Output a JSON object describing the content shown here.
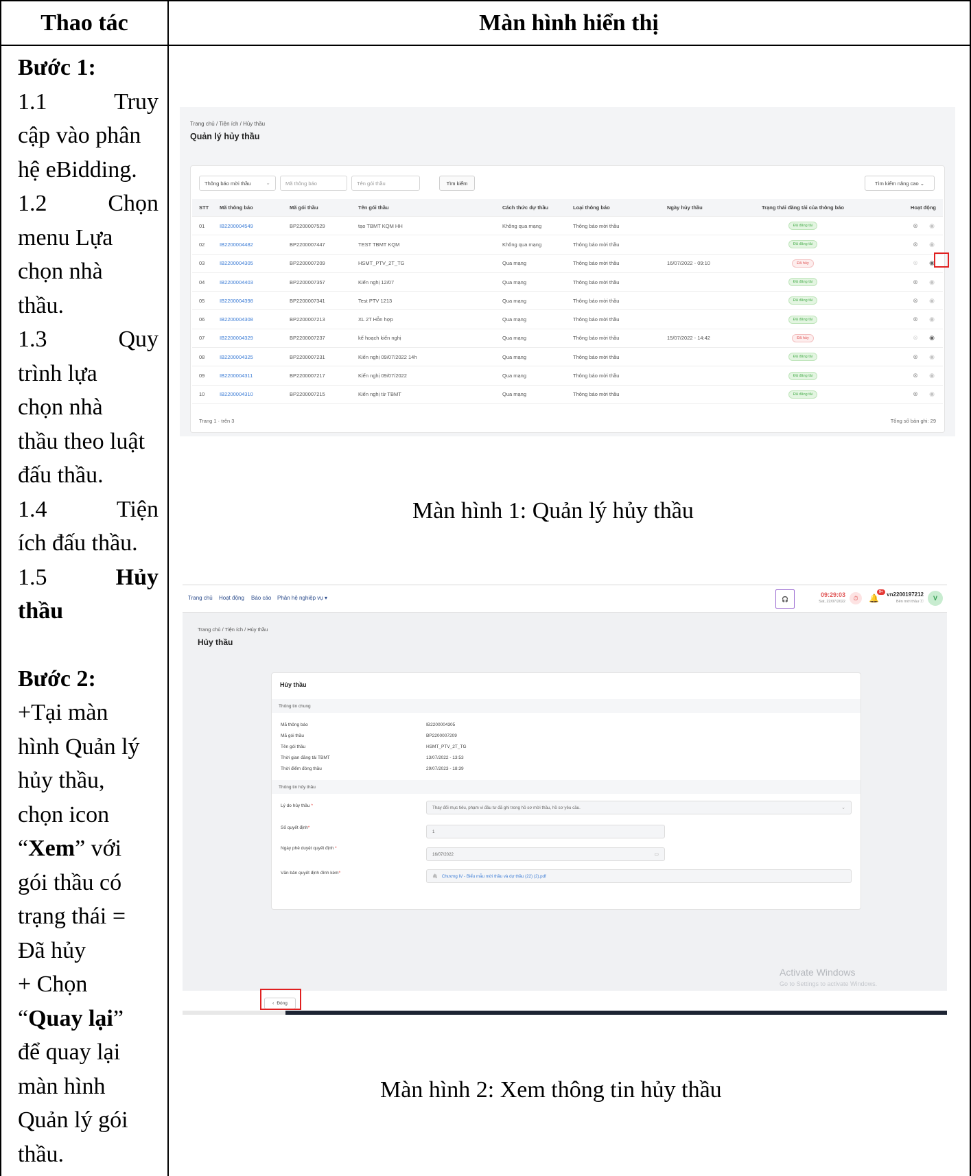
{
  "table_header": {
    "left": "Thao tác",
    "right": "Màn hình hiển thị"
  },
  "steps": {
    "step1_title": "Bước 1:",
    "s1_1_num": "1.1",
    "s1_1_a": "Truy",
    "s1_1_b": "cập vào phân",
    "s1_1_c": "hệ eBidding.",
    "s1_2_num": "1.2",
    "s1_2_a": "Chọn",
    "s1_2_b": "menu Lựa",
    "s1_2_c": "chọn nhà",
    "s1_2_d": "thầu.",
    "s1_3_num": "1.3",
    "s1_3_a": "Quy",
    "s1_3_b": "trình lựa",
    "s1_3_c": "chọn nhà",
    "s1_3_d": "thầu theo luật",
    "s1_3_e": "đấu thầu.",
    "s1_4_num": "1.4",
    "s1_4_a": "Tiện",
    "s1_4_b": "ích đấu thầu.",
    "s1_5_num": "1.5",
    "s1_5_a": "Hủy",
    "s1_5_b": "thầu",
    "step2_title": "Bước 2:",
    "s2_a": "+Tại màn",
    "s2_b": "hình Quản lý",
    "s2_c": "hủy thầu,",
    "s2_d": "chọn icon",
    "s2_e_q1": "“",
    "s2_e_bold": "Xem",
    "s2_e_rest": "” với",
    "s2_f": "gói thầu có",
    "s2_g": "trạng thái =",
    "s2_h": "Đã hủy",
    "s2_i": "+ Chọn",
    "s2_j_q1": "“",
    "s2_j_bold": "Quay lại",
    "s2_j_q2": "”",
    "s2_k": "để quay lại",
    "s2_l": "màn hình",
    "s2_m": "Quản lý gói",
    "s2_n": "thầu."
  },
  "captions": {
    "screen1": "Màn hình 1: Quản lý hủy thầu",
    "screen2": "Màn hình 2: Xem thông tin hủy thầu"
  },
  "screen1": {
    "breadcrumb": "Trang chủ / Tiện ích / Hủy thầu",
    "title": "Quản lý hủy thầu",
    "filters": {
      "type_selected": "Thông báo mời thầu",
      "code_placeholder": "Mã thông báo",
      "name_placeholder": "Tên gói thầu",
      "search_button": "Tìm kiếm",
      "advanced_button": "Tìm kiếm nâng cao"
    },
    "columns": {
      "stt": "STT",
      "ma_tb": "Mã thông báo",
      "ma_goi": "Mã gói thầu",
      "ten_goi": "Tên gói thầu",
      "cach_thuc": "Cách thức dự thầu",
      "loai_tb": "Loại thông báo",
      "ngay_huy": "Ngày hủy thầu",
      "trang_thai": "Trạng thái đăng tải của thông báo",
      "hoat_dong": "Hoạt động"
    },
    "rows": [
      {
        "stt": "01",
        "ma_tb": "IB2200004549",
        "ma_goi": "BP2200007529",
        "ten_goi": "tạo TBMT KQM HH",
        "cach_thuc": "Không qua mạng",
        "loai_tb": "Thông báo mời thầu",
        "ngay_huy": "",
        "trang_thai": "Đã đăng tải"
      },
      {
        "stt": "02",
        "ma_tb": "IB2200004482",
        "ma_goi": "BP2200007447",
        "ten_goi": "TEST TBMT KQM",
        "cach_thuc": "Không qua mạng",
        "loai_tb": "Thông báo mời thầu",
        "ngay_huy": "",
        "trang_thai": "Đã đăng tải"
      },
      {
        "stt": "03",
        "ma_tb": "IB2200004305",
        "ma_goi": "BP2200007209",
        "ten_goi": "HSMT_PTV_2T_TG",
        "cach_thuc": "Qua mạng",
        "loai_tb": "Thông báo mời thầu",
        "ngay_huy": "16/07/2022 - 09:10",
        "trang_thai": "Đã hủy"
      },
      {
        "stt": "04",
        "ma_tb": "IB2200004403",
        "ma_goi": "BP2200007357",
        "ten_goi": "Kiến nghị 12/07",
        "cach_thuc": "Qua mạng",
        "loai_tb": "Thông báo mời thầu",
        "ngay_huy": "",
        "trang_thai": "Đã đăng tải"
      },
      {
        "stt": "05",
        "ma_tb": "IB2200004398",
        "ma_goi": "BP2200007341",
        "ten_goi": "Test PTV 1213",
        "cach_thuc": "Qua mạng",
        "loai_tb": "Thông báo mời thầu",
        "ngay_huy": "",
        "trang_thai": "Đã đăng tải"
      },
      {
        "stt": "06",
        "ma_tb": "IB2200004308",
        "ma_goi": "BP2200007213",
        "ten_goi": "XL 2T Hỗn hợp",
        "cach_thuc": "Qua mạng",
        "loai_tb": "Thông báo mời thầu",
        "ngay_huy": "",
        "trang_thai": "Đã đăng tải"
      },
      {
        "stt": "07",
        "ma_tb": "IB2200004329",
        "ma_goi": "BP2200007237",
        "ten_goi": "kế hoạch kiến nghị",
        "cach_thuc": "Qua mạng",
        "loai_tb": "Thông báo mời thầu",
        "ngay_huy": "15/07/2022 - 14:42",
        "trang_thai": "Đã hủy"
      },
      {
        "stt": "08",
        "ma_tb": "IB2200004325",
        "ma_goi": "BP2200007231",
        "ten_goi": "Kiến nghị 09/07/2022 14h",
        "cach_thuc": "Qua mạng",
        "loai_tb": "Thông báo mời thầu",
        "ngay_huy": "",
        "trang_thai": "Đã đăng tải"
      },
      {
        "stt": "09",
        "ma_tb": "IB2200004311",
        "ma_goi": "BP2200007217",
        "ten_goi": "Kiến nghị 09/07/2022",
        "cach_thuc": "Qua mạng",
        "loai_tb": "Thông báo mời thầu",
        "ngay_huy": "",
        "trang_thai": "Đã đăng tải"
      },
      {
        "stt": "10",
        "ma_tb": "IB2200004310",
        "ma_goi": "BP2200007215",
        "ten_goi": "Kiến nghị từ TBMT",
        "cach_thuc": "Qua mạng",
        "loai_tb": "Thông báo mời thầu",
        "ngay_huy": "",
        "trang_thai": "Đã đăng tải"
      }
    ],
    "pager": "Trang  1  ·  trên 3",
    "total": "Tổng số bản ghi: 29"
  },
  "screen2": {
    "nav": {
      "home": "Trang chủ",
      "activity": "Hoạt động",
      "report": "Báo cáo",
      "module": "Phân hệ nghiệp vụ ▾"
    },
    "clock_time": "09:29:03",
    "clock_date": "Sat, 22/07/2022",
    "notif_count": "9+",
    "user_name": "vn2200197212",
    "user_role": "Bên mời thầu ⓔ",
    "avatar_letter": "V",
    "breadcrumb": "Trang chủ / Tiện ích / Hủy thầu",
    "title": "Hủy thầu",
    "card_title": "Hủy thầu",
    "section_general": "Thông tin chung",
    "info": {
      "ma_tb_label": "Mã thông báo",
      "ma_tb": "IB2200004305",
      "ma_goi_label": "Mã gói thầu",
      "ma_goi": "BP2200007209",
      "ten_goi_label": "Tên gói thầu",
      "ten_goi": "HSMT_PTV_2T_TG",
      "tg_dang_label": "Thời gian đăng tải TBMT",
      "tg_dang": "13/07/2022 - 13:53",
      "tg_dong_label": "Thời điểm đóng thầu",
      "tg_dong": "29/07/2023 - 18:39"
    },
    "section_cancel": "Thông tin hủy thầu",
    "form": {
      "ly_do_label": "Lý do hủy thầu",
      "ly_do": "Thay đổi mục tiêu, phạm vi đầu tư đã ghi trong hồ sơ mời thầu, hồ sơ yêu cầu.",
      "so_qd_label": "Số quyết định",
      "so_qd": "1",
      "ngay_label": "Ngày phê duyệt quyết định",
      "ngay": "16/07/2022",
      "file_label": "Văn bản quyết định đính kèm",
      "file": "Chương IV - Biểu mẫu mời thầu và dự thầu (22) (2).pdf",
      "required_mark": "*"
    },
    "watermark_title": "Activate Windows",
    "watermark_sub": "Go to Settings to activate Windows.",
    "close_button": "Đóng"
  }
}
